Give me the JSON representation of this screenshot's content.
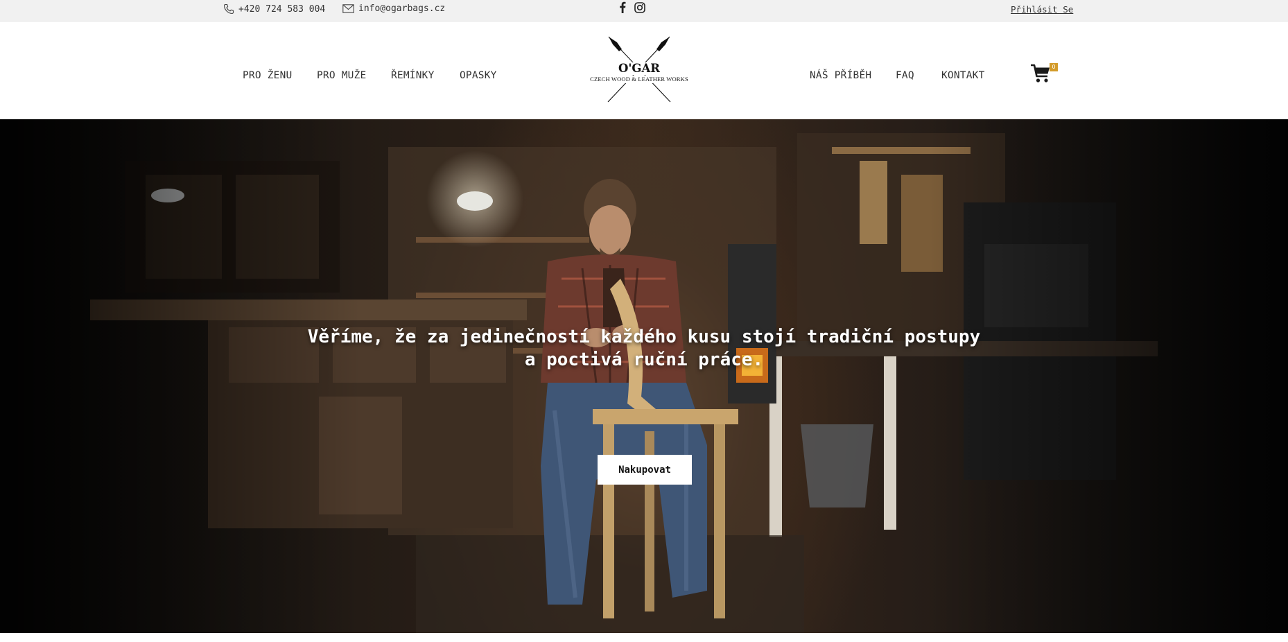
{
  "topbar": {
    "phone": "+420 724 583 004",
    "email": "info@ogarbags.cz",
    "social": [
      {
        "icon": "facebook-icon"
      },
      {
        "icon": "instagram-icon"
      }
    ],
    "login_label": "Přihlásit Se"
  },
  "logo": {
    "name": "O'GAR",
    "tagline": "CZECH WOOD & LEATHER WORKS"
  },
  "nav_left": [
    "PRO ŽENU",
    "PRO MUŽE",
    "ŘEMÍNKY",
    "OPASKY"
  ],
  "nav_right": [
    "NÁŠ PŘÍBĚH",
    "FAQ",
    "KONTAKT"
  ],
  "cart": {
    "icon": "cart-icon",
    "count": "0",
    "badge_color": "#d39b2a"
  },
  "hero": {
    "heading_line1": "Věříme, že za jedinečností každého kusu stojí tradiční postupy",
    "heading_line2": "a poctivá ruční práce.",
    "cta_label": "Nakupovat",
    "image": "leather craftsman sitting on a wooden stool in a dim workshop"
  }
}
